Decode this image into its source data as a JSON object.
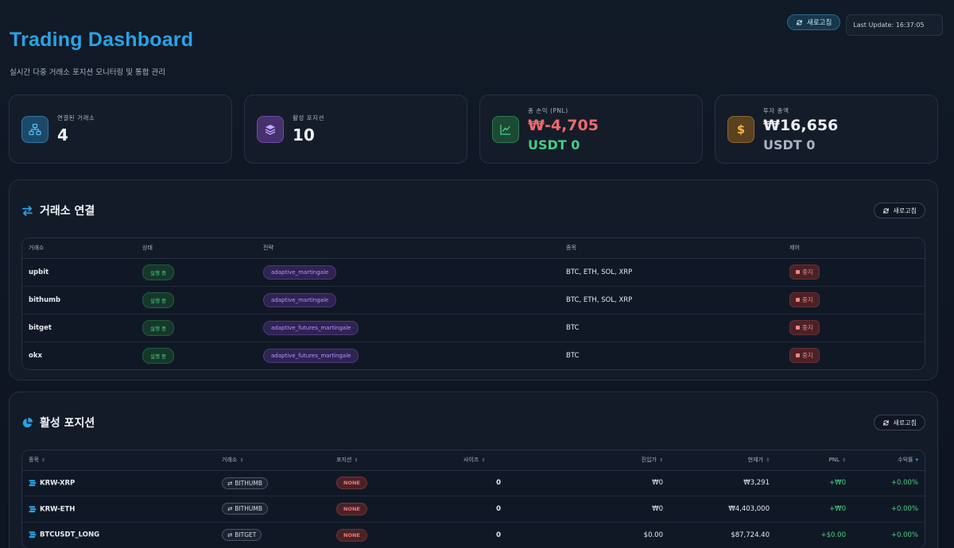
{
  "header": {
    "title": "Trading Dashboard",
    "subtitle": "실시간 다중 거래소 포지션 모니터링 및 통합 관리",
    "refresh_label": "새로고침",
    "last_update": "Last Update: 16:37:05"
  },
  "stats": {
    "exchanges": {
      "label": "연결된 거래소",
      "value": "4",
      "icon": "network-icon"
    },
    "positions": {
      "label": "활성 포지션",
      "value": "10",
      "icon": "layers-icon"
    },
    "pnl": {
      "label": "총 손익 (PNL)",
      "value": "₩-4,705",
      "sub": "USDT 0",
      "icon": "chart-line-icon"
    },
    "investment": {
      "label": "투자 총액",
      "value": "₩16,656",
      "sub": "USDT 0",
      "icon": "dollar-icon"
    }
  },
  "exchanges_panel": {
    "title": "거래소 연결",
    "refresh_label": "새로고침",
    "columns": [
      "거래소",
      "상태",
      "전략",
      "종목",
      "제어"
    ],
    "rows": [
      {
        "exchange": "upbit",
        "status": "실행 중",
        "strategy": "adaptive_martingale",
        "symbols": "BTC, ETH, SOL, XRP",
        "control": "중지"
      },
      {
        "exchange": "bithumb",
        "status": "실행 중",
        "strategy": "adaptive_martingale",
        "symbols": "BTC, ETH, SOL, XRP",
        "control": "중지"
      },
      {
        "exchange": "bitget",
        "status": "실행 중",
        "strategy": "adaptive_futures_martingale",
        "symbols": "BTC",
        "control": "중지"
      },
      {
        "exchange": "okx",
        "status": "실행 중",
        "strategy": "adaptive_futures_martingale",
        "symbols": "BTC",
        "control": "중지"
      }
    ]
  },
  "positions_panel": {
    "title": "활성 포지션",
    "refresh_label": "새로고침",
    "columns": [
      "종목",
      "거래소",
      "포지션",
      "사이즈",
      "진입가",
      "현재가",
      "PNL",
      "수익률"
    ],
    "rows": [
      {
        "symbol": "KRW-XRP",
        "exchange": "BITHUMB",
        "position": "NONE",
        "size": "0",
        "entry": "₩0",
        "current": "₩3,291",
        "pnl": "+₩0",
        "roi": "+0.00%"
      },
      {
        "symbol": "KRW-ETH",
        "exchange": "BITHUMB",
        "position": "NONE",
        "size": "0",
        "entry": "₩0",
        "current": "₩4,403,000",
        "pnl": "+₩0",
        "roi": "+0.00%"
      },
      {
        "symbol": "BTCUSDT_LONG",
        "exchange": "BITGET",
        "position": "NONE",
        "size": "0",
        "entry": "$0.00",
        "current": "$87,724.40",
        "pnl": "+$0.00",
        "roi": "+0.00%"
      }
    ]
  }
}
